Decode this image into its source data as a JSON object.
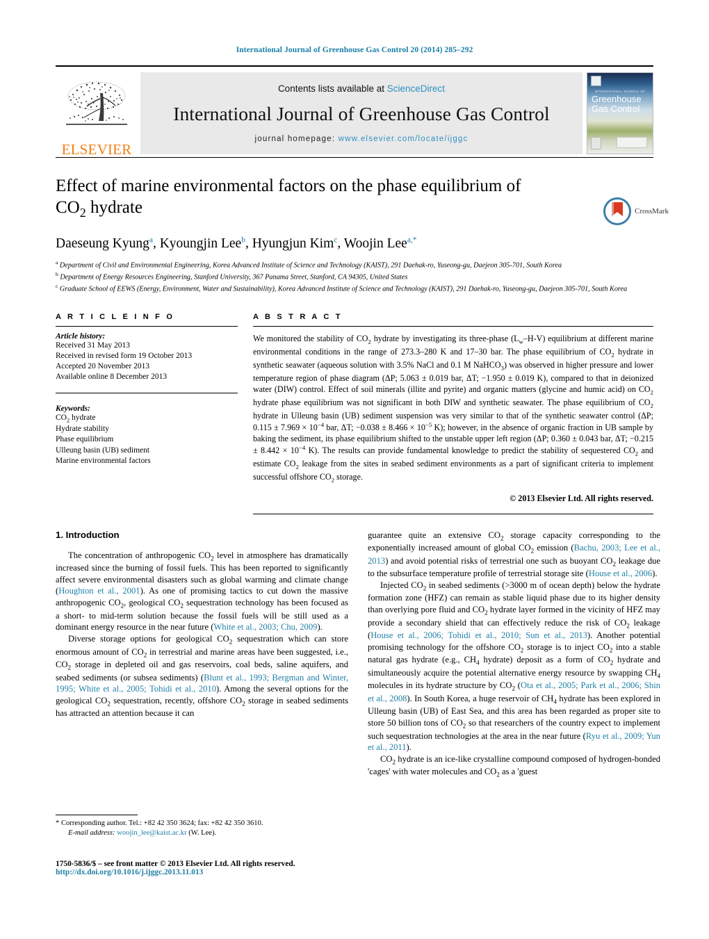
{
  "running_head": "International Journal of Greenhouse Gas Control 20 (2014) 285–292",
  "masthead": {
    "publisher_name": "ELSEVIER",
    "contents_prefix": "Contents lists available at ",
    "contents_link": "ScienceDirect",
    "journal_title": "International Journal of Greenhouse Gas Control",
    "homepage_prefix": "journal homepage: ",
    "homepage_url": "www.elsevier.com/locate/ijggc",
    "cover": {
      "supertitle": "INTERNATIONAL JOURNAL OF",
      "line1": "Greenhouse",
      "line2": "Gas Control"
    }
  },
  "article": {
    "title_line1": "Effect of marine environmental factors on the phase equilibrium of",
    "title_line2_pre": "CO",
    "title_line2_sub": "2",
    "title_line2_post": " hydrate",
    "crossmark_label": "CrossMark",
    "authors": [
      {
        "name": "Daeseung Kyung",
        "marker": "a"
      },
      {
        "name": "Kyoungjin Lee",
        "marker": "b"
      },
      {
        "name": "Hyungjun Kim",
        "marker": "c"
      },
      {
        "name": "Woojin Lee",
        "marker": "a,*"
      }
    ],
    "affiliations": [
      {
        "marker": "a",
        "text": "Department of Civil and Environmental Engineering, Korea Advanced Institute of Science and Technology (KAIST), 291 Daehak-ro, Yuseong-gu, Daejeon 305-701, South Korea"
      },
      {
        "marker": "b",
        "text": "Department of Energy Resources Engineering, Stanford University, 367 Panama Street, Stanford, CA 94305, United States"
      },
      {
        "marker": "c",
        "text": "Graduate School of EEWS (Energy, Environment, Water and Sustainability), Korea Advanced Institute of Science and Technology (KAIST), 291 Daehak-ro, Yuseong-gu, Daejeon 305-701, South Korea"
      }
    ]
  },
  "article_info": {
    "heading": "A R T I C L E   I N F O",
    "history_title": "Article history:",
    "history": [
      "Received 31 May 2013",
      "Received in revised form 19 October 2013",
      "Accepted 20 November 2013",
      "Available online 8 December 2013"
    ],
    "keywords_title": "Keywords:",
    "keywords": [
      "CO2 hydrate",
      "Hydrate stability",
      "Phase equilibrium",
      "Ulleung basin (UB) sediment",
      "Marine environmental factors"
    ]
  },
  "abstract": {
    "heading": "A B S T R A C T",
    "text": "We monitored the stability of CO2 hydrate by investigating its three-phase (Lw–H-V) equilibrium at different marine environmental conditions in the range of 273.3–280 K and 17–30 bar. The phase equilibrium of CO2 hydrate in synthetic seawater (aqueous solution with 3.5% NaCl and 0.1 M NaHCO3) was observed in higher pressure and lower temperature region of phase diagram (ΔP; 5.063 ± 0.019 bar, ΔT; −1.950 ± 0.019 K), compared to that in deionized water (DIW) control. Effect of soil minerals (illite and pyrite) and organic matters (glycine and humic acid) on CO2 hydrate phase equilibrium was not significant in both DIW and synthetic seawater. The phase equilibrium of CO2 hydrate in Ulleung basin (UB) sediment suspension was very similar to that of the synthetic seawater control (ΔP; 0.115 ± 7.969 × 10−4 bar, ΔT; −0.038 ± 8.466 × 10−5 K); however, in the absence of organic fraction in UB sample by baking the sediment, its phase equilibrium shifted to the unstable upper left region (ΔP; 0.360 ± 0.043 bar, ΔT; −0.215 ± 8.442 × 10−4 K). The results can provide fundamental knowledge to predict the stability of sequestered CO2 and estimate CO2 leakage from the sites in seabed sediment environments as a part of significant criteria to implement successful offshore CO2 storage.",
    "copyright": "© 2013 Elsevier Ltd. All rights reserved."
  },
  "introduction": {
    "heading": "1.  Introduction",
    "left_paragraphs": [
      "The concentration of anthropogenic CO2 level in atmosphere has dramatically increased since the burning of fossil fuels. This has been reported to significantly affect severe environmental disasters such as global warming and climate change (Houghton et al., 2001). As one of promising tactics to cut down the massive anthropogenic CO2, geological CO2 sequestration technology has been focused as a short- to mid-term solution because the fossil fuels will be still used as a dominant energy resource in the near future (White et al., 2003; Chu, 2009).",
      "Diverse storage options for geological CO2 sequestration which can store enormous amount of CO2 in terrestrial and marine areas have been suggested, i.e., CO2 storage in depleted oil and gas reservoirs, coal beds, saline aquifers, and seabed sediments (or subsea sediments) (Blunt et al., 1993; Bergman and Winter, 1995; White et al., 2005; Tohidi et al., 2010). Among the several options for the geological CO2 sequestration, recently, offshore CO2 storage in seabed sediments has attracted an attention because it can"
    ],
    "right_paragraphs": [
      "guarantee quite an extensive CO2 storage capacity corresponding to the exponentially increased amount of global CO2 emission (Bachu, 2003; Lee et al., 2013) and avoid potential risks of terrestrial one such as buoyant CO2 leakage due to the subsurface temperature profile of terrestrial storage site (House et al., 2006).",
      "Injected CO2 in seabed sediments (>3000 m of ocean depth) below the hydrate formation zone (HFZ) can remain as stable liquid phase due to its higher density than overlying pore fluid and CO2 hydrate layer formed in the vicinity of HFZ may provide a secondary shield that can effectively reduce the risk of CO2 leakage (House et al., 2006; Tohidi et al., 2010; Sun et al., 2013). Another potential promising technology for the offshore CO2 storage is to inject CO2 into a stable natural gas hydrate (e.g., CH4 hydrate) deposit as a form of CO2 hydrate and simultaneously acquire the potential alternative energy resource by swapping CH4 molecules in its hydrate structure by CO2 (Ota et al., 2005; Park et al., 2006; Shin et al., 2008). In South Korea, a huge reservoir of CH4 hydrate has been explored in Ulleung basin (UB) of East Sea, and this area has been regarded as proper site to store 50 billion tons of CO2 so that researchers of the country expect to implement such sequestration technologies at the area in the near future (Ryu et al., 2009; Yun et al., 2011).",
      "CO2 hydrate is an ice-like crystalline compound composed of hydrogen-bonded 'cages' with water molecules and CO2 as a 'guest"
    ]
  },
  "footnote": {
    "corresponding": "* Corresponding author. Tel.: +82 42 350 3624; fax: +82 42 350 3610.",
    "email_label": "E-mail address:",
    "email": "woojin_lee@kaist.ac.kr",
    "email_suffix": "(W. Lee)."
  },
  "bottom": {
    "issn": "1750-5836/$ – see front matter © 2013 Elsevier Ltd. All rights reserved.",
    "doi": "http://dx.doi.org/10.1016/j.ijggc.2013.11.013"
  },
  "colors": {
    "link": "#1f7fa6",
    "elsevier_orange": "#f07f13",
    "masthead_bg": "#e9e9e9"
  }
}
